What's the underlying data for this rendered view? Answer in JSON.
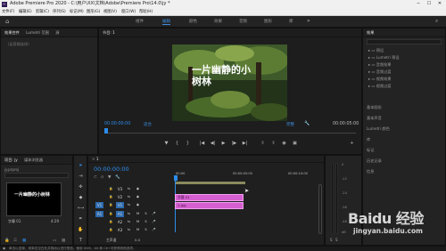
{
  "titlebar": {
    "text": "Adobe Premiere Pro 2020 - C:\\用户\\XX\\文档\\Adobe\\Premiere Pro\\14.0\\jy *",
    "minimize": "─",
    "maximize": "☐",
    "close": "✕"
  },
  "menu": [
    "文件(F)",
    "编辑(E)",
    "剪辑(C)",
    "序列(S)",
    "标记(M)",
    "图形(G)",
    "视图(V)",
    "窗口(W)",
    "帮助(H)"
  ],
  "workspaces": [
    "组件",
    "编辑",
    "颜色",
    "效果",
    "音频",
    "图形",
    "库"
  ],
  "source_panel": {
    "tabs": [
      "效果控件",
      "Lumetri 范围",
      "源"
    ],
    "empty_text": "（无剪辑选择）"
  },
  "program": {
    "tab_label": "节目: 1",
    "video_title": "一片幽静的小树林",
    "timecode_left": "00:00:00:00",
    "fit_label": "适合",
    "quality_label": "完整",
    "timecode_right": "00:00:05:00"
  },
  "effects": {
    "tab_label": "效果",
    "folders": [
      "预设",
      "Lumetri 预设",
      "音频效果",
      "音频过渡",
      "视频效果",
      "视频过渡"
    ],
    "sections": [
      "基本图形",
      "基本声音",
      "Lumetri 颜色",
      "库",
      "标记",
      "历史记录",
      "信息"
    ]
  },
  "project": {
    "tabs": [
      "项目: jy",
      "媒体浏览器"
    ],
    "filename": "jy.prproj",
    "thumb_caption": "一片幽静的小树林",
    "thumb_name": "字幕 01",
    "thumb_duration": "4:29"
  },
  "timeline": {
    "tab_label": "1",
    "timecode": "00:00:00:00",
    "ruler_labels": [
      "00:00",
      "00:00:05:00",
      "00:00:10:00"
    ],
    "video_tracks": [
      "V3",
      "V2",
      "V1"
    ],
    "audio_tracks": [
      "A1",
      "A2",
      "A3"
    ],
    "left_tracks": [
      "V1",
      "A1"
    ],
    "clip1": "字幕 01",
    "clip2": "1.jpg",
    "master_label": "主声道",
    "master_value": "0.0"
  },
  "meter_labels": [
    "0",
    "-12",
    "-24",
    "-36",
    "-48",
    "dB"
  ],
  "meter_solo": [
    "S",
    "S"
  ],
  "statusbar": "单击以选择，或单击空白处并拖动以进行框选。使用 Shift、Alt 和 Ctrl 可获得其他选项。",
  "watermark": {
    "brand": "Baidu 经验",
    "url": "jingyan.baidu.com"
  },
  "colors": {
    "accent": "#2d8ceb",
    "clip": "#d55fd0",
    "panel": "#232323"
  }
}
